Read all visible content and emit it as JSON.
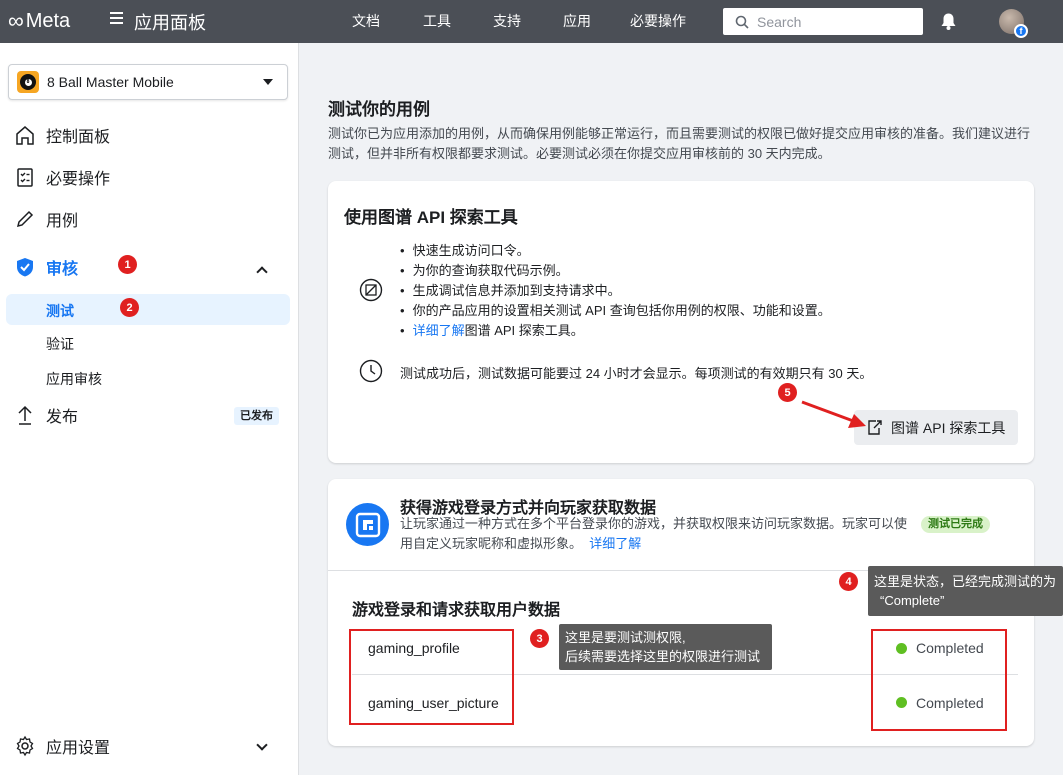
{
  "topbar": {
    "logo_text": "Meta",
    "title": "应用面板",
    "nav": [
      "文档",
      "工具",
      "支持",
      "应用",
      "必要操作"
    ],
    "search_placeholder": "Search"
  },
  "sidebar": {
    "app_name": "8 Ball Master Mobile",
    "items": [
      {
        "label": "控制面板"
      },
      {
        "label": "必要操作"
      },
      {
        "label": "用例"
      },
      {
        "label": "审核",
        "badge": "1"
      },
      {
        "label": "测试",
        "badge": "2"
      },
      {
        "label": "验证"
      },
      {
        "label": "应用审核"
      },
      {
        "label": "发布",
        "tag": "已发布"
      },
      {
        "label": "应用设置"
      }
    ]
  },
  "main": {
    "title": "测试你的用例",
    "description": "测试你已为应用添加的用例，从而确保用例能够正常运行，而且需要测试的权限已做好提交应用审核的准备。我们建议进行测试，但并非所有权限都要求测试。必要测试必须在你提交应用审核前的 30 天内完成。",
    "explorer_card": {
      "title": "使用图谱 API 探索工具",
      "bullets": [
        "快速生成访问口令。",
        "为你的查询获取代码示例。",
        "生成调试信息并添加到支持请求中。",
        "你的产品应用的设置相关测试 API 查询包括你用例的权限、功能和设置。"
      ],
      "learn_more_link": "详细了解",
      "learn_more_rest": "图谱 API 探索工具。",
      "note": "测试成功后，测试数据可能要过 24 小时才会显示。每项测试的有效期只有 30 天。",
      "button_label": "图谱 API 探索工具"
    },
    "gaming_card": {
      "title": "获得游戏登录方式并向玩家获取数据",
      "description": "让玩家通过一种方式在多个平台登录你的游戏，并获取权限来访问玩家数据。玩家可以使用自定义玩家昵称和虚拟形象。",
      "learn_more": "详细了解",
      "status_pill": "测试已完成",
      "section_title": "游戏登录和请求获取用户数据",
      "permissions": [
        {
          "name": "gaming_profile",
          "status": "Completed"
        },
        {
          "name": "gaming_user_picture",
          "status": "Completed"
        }
      ]
    }
  },
  "annotations": {
    "badge3": "3",
    "tip3_line1": "这里是要测试测权限,",
    "tip3_line2": "后续需要选择这里的权限进行测试",
    "badge4": "4",
    "tip4_line1": "这里是状态，已经完成测试的为",
    "tip4_line2": "“Complete”",
    "badge5": "5"
  },
  "colors": {
    "brand": "#1877f2",
    "topbar": "#4b4f56",
    "annotation_red": "#e02020",
    "status_green": "#5fbf22"
  }
}
